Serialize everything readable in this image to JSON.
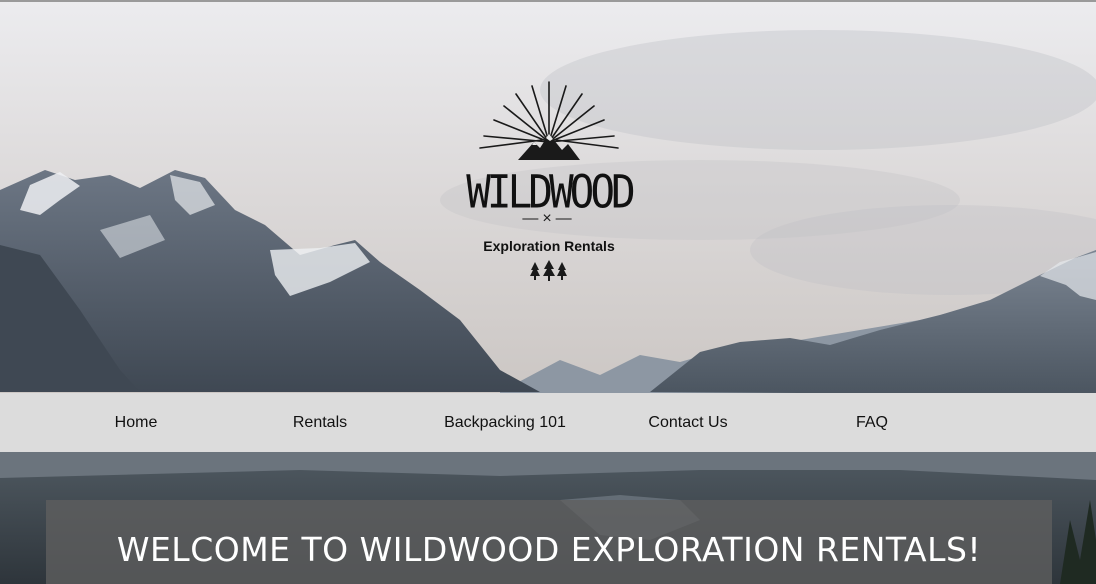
{
  "logo": {
    "name": "WILDWOOD",
    "tagline": "Exploration Rentals",
    "separator": "—×—"
  },
  "nav": {
    "items": [
      {
        "label": "Home"
      },
      {
        "label": "Rentals"
      },
      {
        "label": "Backpacking 101"
      },
      {
        "label": "Contact Us"
      },
      {
        "label": "FAQ"
      }
    ]
  },
  "welcome": {
    "title": "WELCOME TO WILDWOOD EXPLORATION RENTALS!"
  },
  "colors": {
    "nav_background": "#dcdcdc",
    "welcome_box": "#5f5f5f",
    "text_dark": "#111111",
    "text_light": "#ffffff"
  }
}
